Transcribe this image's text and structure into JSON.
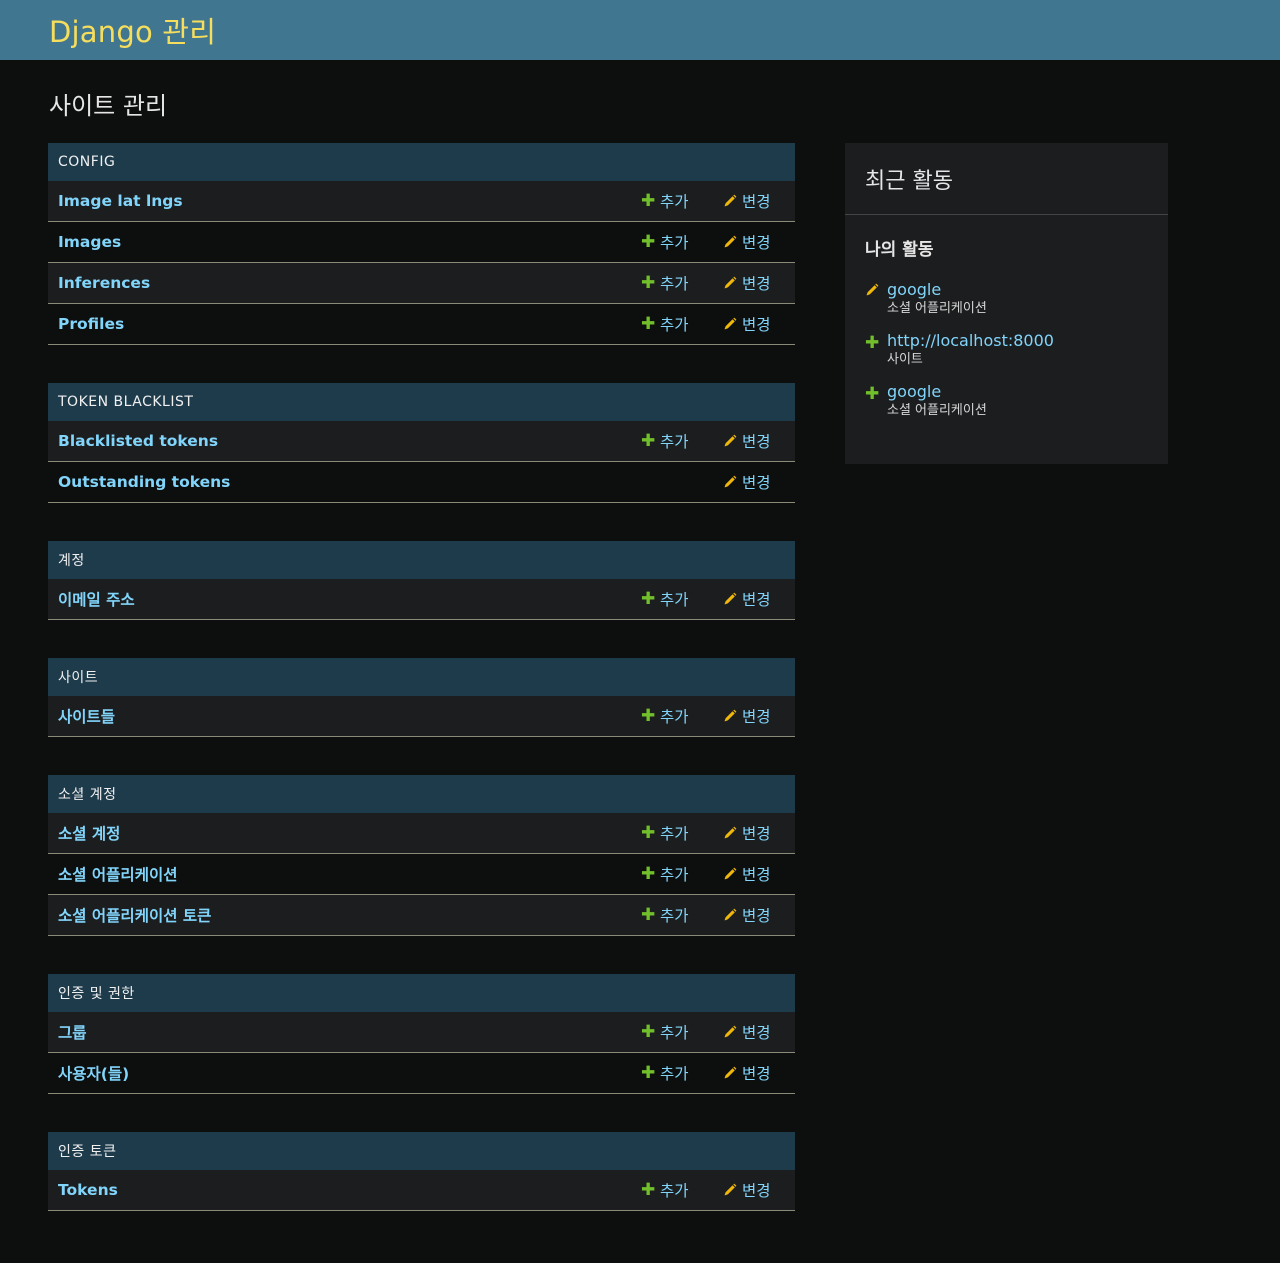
{
  "header": {
    "site_name": "Django 관리"
  },
  "page_title": "사이트 관리",
  "labels": {
    "add": "추가",
    "change": "변경"
  },
  "colors": {
    "header_bg": "#417690",
    "brand_text": "#f5dd5d",
    "module_caption_bg": "#1e3b4c",
    "link": "#81d4fa",
    "add_icon": "#70bf2b",
    "change_icon": "#efb80b"
  },
  "modules": [
    {
      "caption": "CONFIG",
      "models": [
        {
          "name": "Image lat lngs",
          "add": true,
          "change": true
        },
        {
          "name": "Images",
          "add": true,
          "change": true
        },
        {
          "name": "Inferences",
          "add": true,
          "change": true
        },
        {
          "name": "Profiles",
          "add": true,
          "change": true
        }
      ]
    },
    {
      "caption": "TOKEN BLACKLIST",
      "models": [
        {
          "name": "Blacklisted tokens",
          "add": true,
          "change": true
        },
        {
          "name": "Outstanding tokens",
          "add": false,
          "change": true
        }
      ]
    },
    {
      "caption": "계정",
      "models": [
        {
          "name": "이메일 주소",
          "add": true,
          "change": true
        }
      ]
    },
    {
      "caption": "사이트",
      "models": [
        {
          "name": "사이트들",
          "add": true,
          "change": true
        }
      ]
    },
    {
      "caption": "소셜 계정",
      "models": [
        {
          "name": "소셜 계정",
          "add": true,
          "change": true
        },
        {
          "name": "소셜 어플리케이션",
          "add": true,
          "change": true
        },
        {
          "name": "소셜 어플리케이션 토큰",
          "add": true,
          "change": true
        }
      ]
    },
    {
      "caption": "인증 및 권한",
      "models": [
        {
          "name": "그룹",
          "add": true,
          "change": true
        },
        {
          "name": "사용자(들)",
          "add": true,
          "change": true
        }
      ]
    },
    {
      "caption": "인증 토큰",
      "models": [
        {
          "name": "Tokens",
          "add": true,
          "change": true
        }
      ]
    }
  ],
  "recent_actions": {
    "title": "최근 활동",
    "subtitle": "나의 활동",
    "items": [
      {
        "icon": "change-icon",
        "object": "google",
        "type": "소셜 어플리케이션"
      },
      {
        "icon": "add-icon",
        "object": "http://localhost:8000",
        "type": "사이트"
      },
      {
        "icon": "add-icon",
        "object": "google",
        "type": "소셜 어플리케이션"
      }
    ]
  }
}
